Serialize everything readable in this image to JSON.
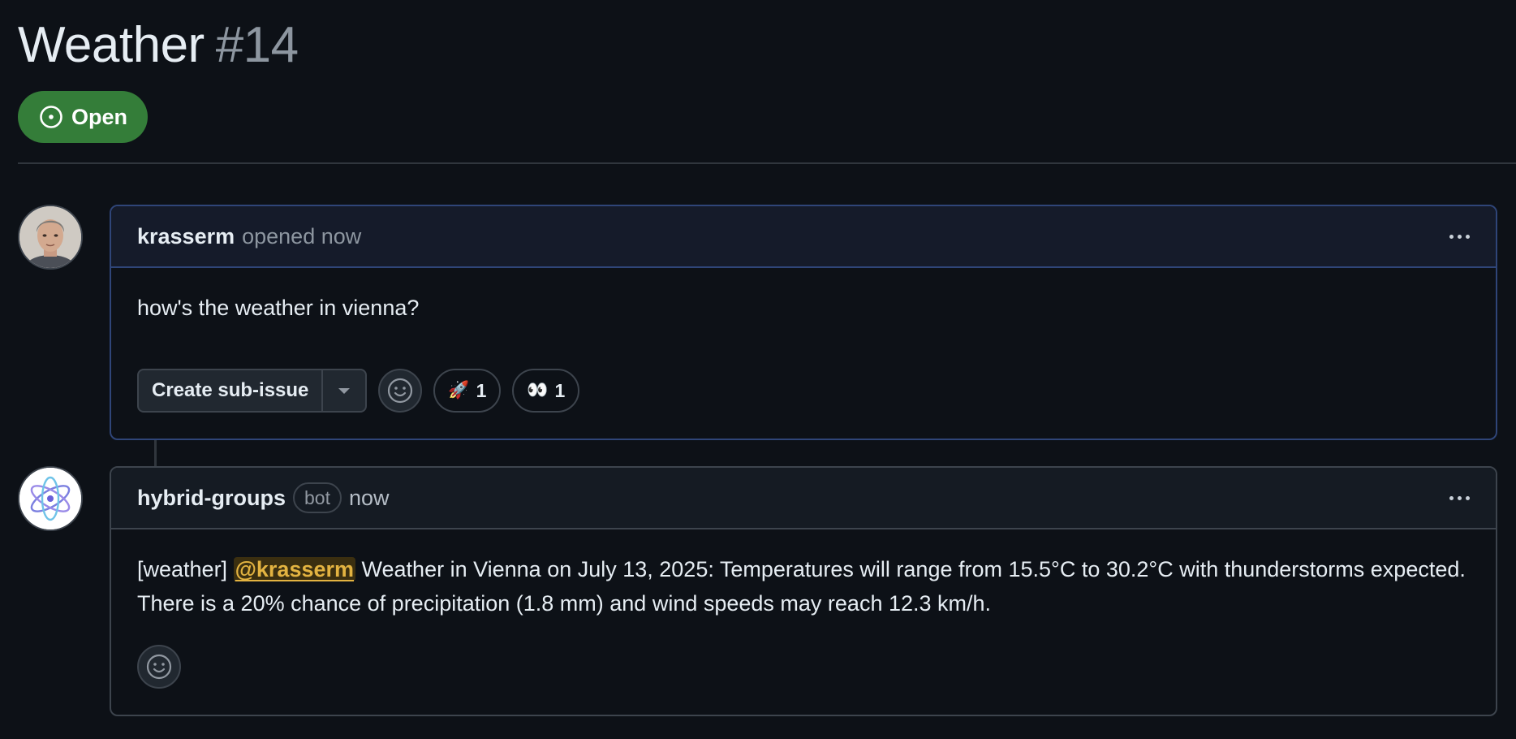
{
  "issue": {
    "title": "Weather",
    "number": "#14",
    "state": "Open"
  },
  "comments": [
    {
      "author": "krasserm",
      "meta": "opened now",
      "body": "how's the weather in vienna?",
      "create_sub_issue_label": "Create sub-issue",
      "reactions": [
        {
          "emoji": "🚀",
          "count": "1"
        },
        {
          "emoji": "👀",
          "count": "1"
        }
      ]
    },
    {
      "author": "hybrid-groups",
      "badge": "bot",
      "meta": "now",
      "body_prefix": "[weather]",
      "mention": "@krasserm",
      "body_text": "Weather in Vienna on July 13, 2025: Temperatures will range from 15.5°C to 30.2°C with thunderstorms expected. There is a 20% chance of precipitation (1.8 mm) and wind speeds may reach 12.3 km/h."
    }
  ],
  "icons": {
    "state": "issue-opened-icon",
    "more": "kebab-horizontal-icon",
    "add_reaction": "smiley-icon",
    "dropdown": "triangle-down-icon"
  },
  "colors": {
    "background": "#0d1117",
    "open_badge": "#347d39",
    "mention": "#e3b341",
    "muted_text": "#8d96a0",
    "border": "#3d444d",
    "highlight_border": "#2f4578"
  }
}
